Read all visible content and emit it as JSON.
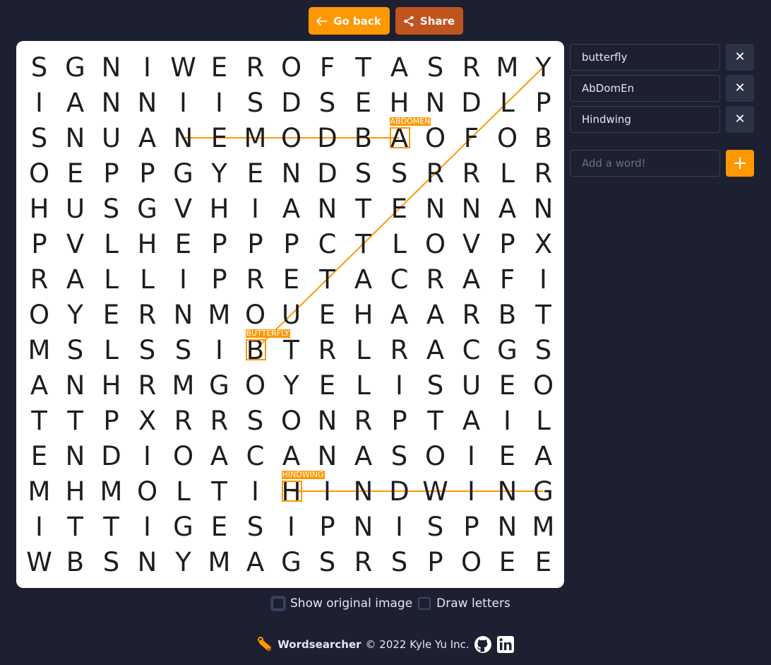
{
  "header": {
    "back_label": "Go back",
    "share_label": "Share"
  },
  "grid": {
    "rows": [
      "SGNIWEROFTASRMY",
      "IANNIISDSEHNDLP",
      "SNUANEMODBAOFOB",
      "OEPPGYENDSSRRLR",
      "HUSGVHIANTENNAN",
      "PVLHEPPPCTLOVPX",
      "RALLIPRETACRAFI",
      "OYERNMOUEHAARBT",
      "MSLSSIBTRLRACGS",
      "ANHRMGOYELISUEO",
      "TTPXRRSONRPTAIL",
      "ENDIOACANASOIEA",
      "MHMOLTIHINDWING",
      "ITTIGESIPNISPNM",
      "WBSNYMAGSRSPOEE"
    ]
  },
  "found": [
    {
      "label": "ABDOMEN",
      "start": [
        2,
        10
      ],
      "end": [
        2,
        4
      ]
    },
    {
      "label": "BUTTERFLY",
      "start": [
        8,
        6
      ],
      "end": [
        0,
        14
      ]
    },
    {
      "label": "HINDWING",
      "start": [
        12,
        7
      ],
      "end": [
        12,
        14
      ]
    }
  ],
  "highlight_color": "#ff9800",
  "words": [
    "butterfly",
    "AbDomEn",
    "Hindwing"
  ],
  "add_word": {
    "placeholder": "Add a word!"
  },
  "options": {
    "show_original_label": "Show original image",
    "draw_letters_label": "Draw letters"
  },
  "footer": {
    "brand": "Wordsearcher",
    "copyright": "© 2022 Kyle Yu Inc."
  },
  "colors": {
    "background": "#1c2030",
    "accent": "#ff9800",
    "share": "#c0541f"
  }
}
